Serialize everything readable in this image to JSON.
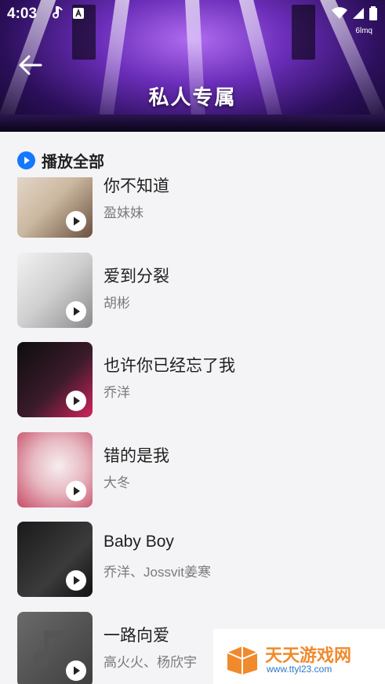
{
  "status_bar": {
    "time": "4:03",
    "carrier_tag": "6lmq"
  },
  "header": {
    "title": "私人专属"
  },
  "play_all": {
    "label": "播放全部"
  },
  "songs": [
    {
      "title": "你不知道",
      "artist": "盈妹妹"
    },
    {
      "title": "爱到分裂",
      "artist": "胡彬"
    },
    {
      "title": "也许你已经忘了我",
      "artist": "乔洋"
    },
    {
      "title": "错的是我",
      "artist": "大冬"
    },
    {
      "title": "Baby Boy",
      "artist": "乔洋、Jossvit姜寒"
    },
    {
      "title": "一路向爱",
      "artist": "高火火、杨欣宇"
    }
  ],
  "watermark": {
    "name": "天天游戏网",
    "url": "www.ttyl23.com"
  },
  "colors": {
    "accent": "#1677ff",
    "header_purple": "#6a2db8",
    "watermark_orange": "#f08a2c"
  }
}
